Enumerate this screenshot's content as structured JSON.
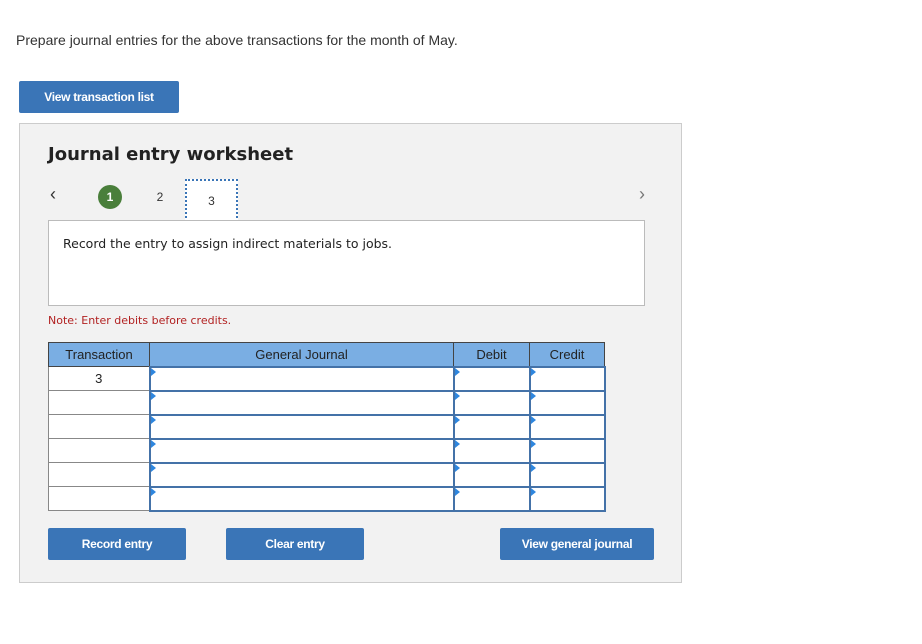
{
  "intro_text": "Prepare journal entries for the above transactions for the month of May.",
  "view_transaction_list_label": "View transaction list",
  "worksheet": {
    "title": "Journal entry worksheet",
    "nav": {
      "prev_icon": "‹",
      "next_icon": "›",
      "steps": [
        {
          "label": "1",
          "state": "completed"
        },
        {
          "label": "2",
          "state": "default"
        },
        {
          "label": "3",
          "state": "current"
        }
      ]
    },
    "description": "Record the entry to assign indirect materials to jobs.",
    "note": "Note: Enter debits before credits.",
    "table": {
      "headers": [
        "Transaction",
        "General Journal",
        "Debit",
        "Credit"
      ],
      "rows": [
        {
          "transaction": "3",
          "account": "",
          "debit": "",
          "credit": ""
        },
        {
          "transaction": "",
          "account": "",
          "debit": "",
          "credit": ""
        },
        {
          "transaction": "",
          "account": "",
          "debit": "",
          "credit": ""
        },
        {
          "transaction": "",
          "account": "",
          "debit": "",
          "credit": ""
        },
        {
          "transaction": "",
          "account": "",
          "debit": "",
          "credit": ""
        },
        {
          "transaction": "",
          "account": "",
          "debit": "",
          "credit": ""
        }
      ]
    },
    "buttons": {
      "record": "Record entry",
      "clear": "Clear entry",
      "view_journal": "View general journal"
    }
  },
  "colors": {
    "button_blue": "#3a75b7",
    "header_blue": "#7aaee3",
    "completed_green": "#4a7f3b",
    "note_red": "#b22222"
  }
}
